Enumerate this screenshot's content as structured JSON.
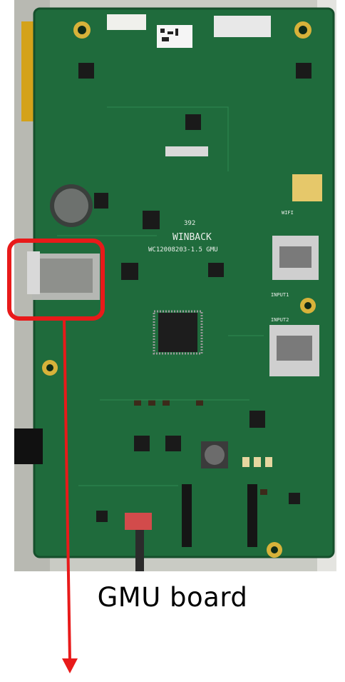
{
  "caption": "GMU board",
  "board": {
    "brand_silkscreen": "WINBACK",
    "model_silkscreen": "WC12008203-1.5 GMU",
    "lot_silkscreen": "392",
    "connector_labels": [
      "INPUT1",
      "INPUT2",
      "WIFI"
    ]
  },
  "colors": {
    "pcb": "#1f6b3c",
    "highlight": "#e81a1a"
  },
  "callout": {
    "target": "microSD card slot",
    "icon": "arrow-down-icon"
  }
}
